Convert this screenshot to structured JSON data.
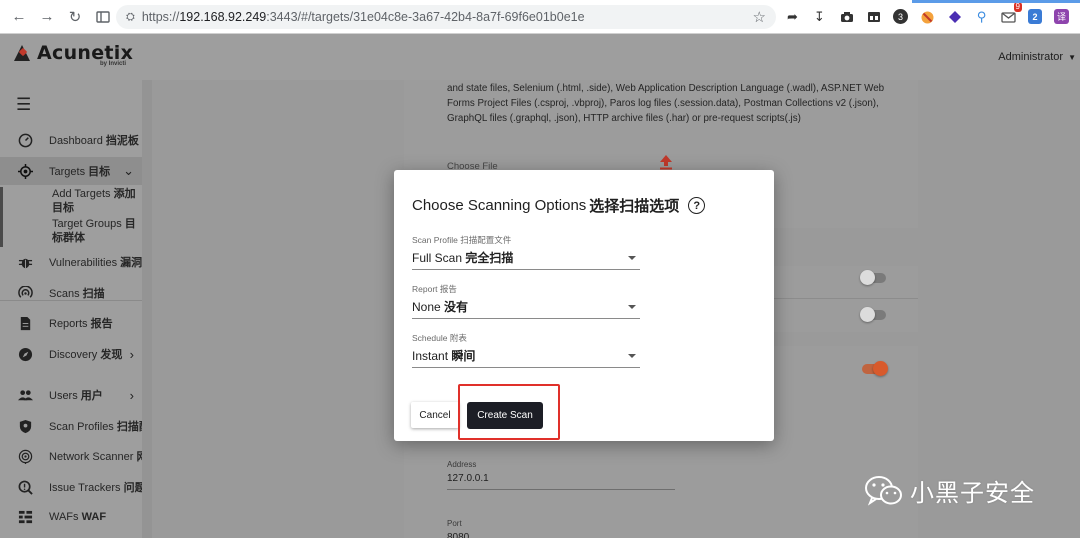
{
  "browser": {
    "url_scheme": "https://",
    "url_host": "192.168.92.249",
    "url_rest": ":3443/#/targets/31e04c8e-3a67-42b4-8a7f-69f6e01b0e1e",
    "extension_badge": "9",
    "ext_labels": [
      "3",
      "2",
      "译"
    ]
  },
  "app": {
    "logo_text": "Acunetix",
    "logo_sub": "by Invicti",
    "user": "Administrator"
  },
  "sidebar": {
    "items": [
      {
        "label": "Dashboard",
        "label_cn": "挡泥板",
        "icon": "gauge-icon"
      },
      {
        "label": "Targets",
        "label_cn": "目标",
        "icon": "crosshair-icon"
      },
      {
        "label": "Vulnerabilities",
        "label_cn": "漏洞",
        "icon": "bug-icon"
      },
      {
        "label": "Scans",
        "label_cn": "扫描",
        "icon": "radar-icon"
      },
      {
        "label": "Reports",
        "label_cn": "报告",
        "icon": "report-icon"
      },
      {
        "label": "Discovery",
        "label_cn": "发现",
        "icon": "compass-icon"
      },
      {
        "label": "Users",
        "label_cn": "用户",
        "icon": "users-icon"
      },
      {
        "label": "Scan Profiles",
        "label_cn": "扫描配",
        "icon": "shield-icon"
      },
      {
        "label": "Network Scanner",
        "label_cn": "网络",
        "icon": "network-icon"
      },
      {
        "label": "Issue Trackers",
        "label_cn": "问题跟",
        "icon": "issue-icon"
      },
      {
        "label": "WAFs",
        "label_cn": "WAF",
        "icon": "waf-icon"
      }
    ],
    "sub_items": [
      {
        "label": "Add Targets",
        "label_cn": "添加目标"
      },
      {
        "label": "Target Groups",
        "label_cn": "目标群体"
      }
    ]
  },
  "main": {
    "file_types_text": "and state files, Selenium (.html, .side), Web Application Description Language (.wadl), ASP.NET Web Forms Project Files (.csproj, .vbproj), Paros log files (.session.data), Postman Collections v2 (.json), GraphQL files (.graphql, .json), HTTP archive files (.har) or pre-request scripts(.js)",
    "choose_file": "Choose File",
    "address_label": "Address",
    "address_value": "127.0.0.1",
    "port_label": "Port",
    "port_value": "8080"
  },
  "modal": {
    "title": "Choose Scanning Options",
    "title_cn": "选择扫描选项",
    "help": "?",
    "scan_profile": {
      "label": "Scan Profile",
      "label_cn": "扫描配置文件",
      "value": "Full Scan",
      "value_cn": "完全扫描"
    },
    "report": {
      "label": "Report",
      "label_cn": "报告",
      "value": "None",
      "value_cn": "没有"
    },
    "schedule": {
      "label": "Schedule",
      "label_cn": "附表",
      "value": "Instant",
      "value_cn": "瞬间"
    },
    "cancel_label": "Cancel",
    "create_label": "Create Scan"
  },
  "watermark": {
    "text": "小黑子安全"
  },
  "colors": {
    "accent": "#d85a2c",
    "create_button": "#1c1e26",
    "highlight": "#e0302a"
  }
}
